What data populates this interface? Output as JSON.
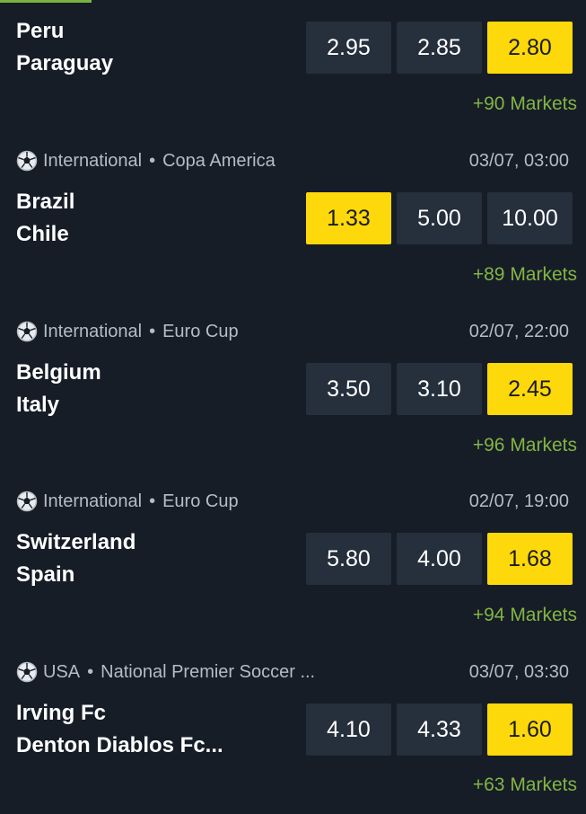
{
  "colors": {
    "background": "#161d27",
    "odds_button": "#262f3c",
    "odds_selected": "#fdd80a",
    "markets_link": "#84b444",
    "meta_text": "#b6bcc5"
  },
  "matches": [
    {
      "sport_icon": "soccer-ball-icon",
      "home": "Peru",
      "away": "Paraguay",
      "odds": [
        "2.95",
        "2.85",
        "2.80"
      ],
      "selected_index": 2,
      "markets": "+90 Markets"
    },
    {
      "sport_icon": "soccer-ball-icon",
      "region": "International",
      "separator": "•",
      "competition": "Copa America",
      "datetime": "03/07, 03:00",
      "home": "Brazil",
      "away": "Chile",
      "odds": [
        "1.33",
        "5.00",
        "10.00"
      ],
      "selected_index": 0,
      "markets": "+89 Markets"
    },
    {
      "sport_icon": "soccer-ball-icon",
      "region": "International",
      "separator": "•",
      "competition": "Euro Cup",
      "datetime": "02/07, 22:00",
      "home": "Belgium",
      "away": "Italy",
      "odds": [
        "3.50",
        "3.10",
        "2.45"
      ],
      "selected_index": 2,
      "markets": "+96 Markets"
    },
    {
      "sport_icon": "soccer-ball-icon",
      "region": "International",
      "separator": "•",
      "competition": "Euro Cup",
      "datetime": "02/07, 19:00",
      "home": "Switzerland",
      "away": "Spain",
      "odds": [
        "5.80",
        "4.00",
        "1.68"
      ],
      "selected_index": 2,
      "markets": "+94 Markets"
    },
    {
      "sport_icon": "soccer-ball-icon",
      "region": "USA",
      "separator": "•",
      "competition": "National Premier Soccer ...",
      "datetime": "03/07, 03:30",
      "home": "Irving Fc",
      "away": "Denton Diablos Fc...",
      "odds": [
        "4.10",
        "4.33",
        "1.60"
      ],
      "selected_index": 2,
      "markets": "+63 Markets"
    }
  ]
}
